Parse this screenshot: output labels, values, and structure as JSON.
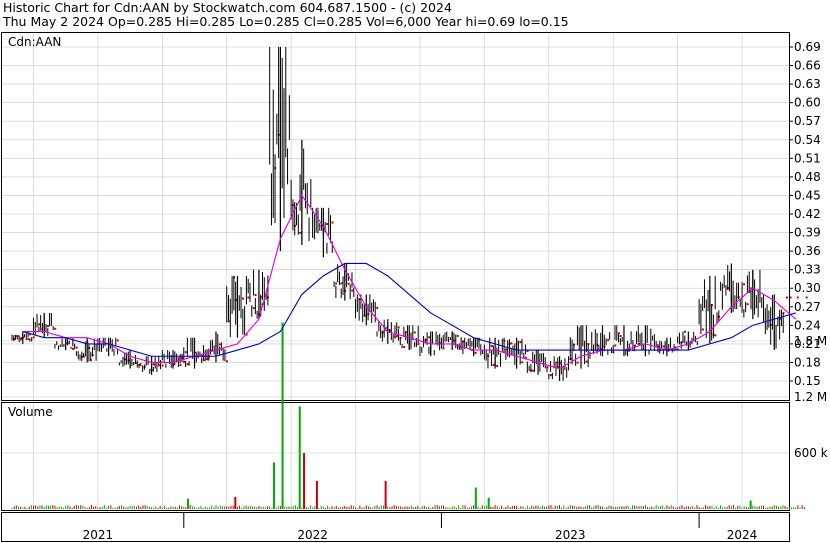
{
  "header": {
    "line1": "Historic Chart for Cdn:AAN by Stockwatch.com 604.687.1500 - (c) 2024",
    "line2": "Thu May  2 2024  Op=0.285  Hi=0.285  Lo=0.285  Cl=0.285  Vol=6,000  Year hi=0.69  lo=0.15"
  },
  "colors": {
    "price_bar": "#000000",
    "down_day_marker": "#cc0000",
    "ma_short": "#e000e0",
    "ma_long": "#0000cc",
    "volume_up": "#00aa00",
    "volume_down": "#cc0000",
    "grid": "#c8c8c8"
  },
  "chart_data": [
    {
      "type": "line",
      "panel": "price",
      "title": "Cdn:AAN",
      "x_axis": {
        "ticks": [
          "2021",
          "2022",
          "2023",
          "2024"
        ],
        "range": [
          "2021-05",
          "2024-05"
        ]
      },
      "y_axis": {
        "ticks": [
          0.69,
          0.66,
          0.63,
          0.6,
          0.57,
          0.54,
          0.51,
          0.48,
          0.45,
          0.42,
          0.39,
          0.36,
          0.33,
          0.3,
          0.27,
          0.24,
          0.21,
          0.18,
          0.15
        ],
        "tick_labels": [
          "0.69",
          "0.66",
          "0.63",
          "0.60",
          "0.57",
          "0.54",
          "0.51",
          "0.48",
          "0.45",
          "0.42",
          "0.39",
          "0.36",
          "0.33",
          "0.30",
          "0.27",
          "0.24",
          "0.21",
          "0.18",
          "0.15"
        ],
        "range": [
          0.15,
          0.69
        ],
        "position": "right"
      },
      "grid": true,
      "price_bars": [
        {
          "date": "2021-05",
          "high": 0.23,
          "low": 0.21
        },
        {
          "date": "2021-06",
          "high": 0.26,
          "low": 0.22
        },
        {
          "date": "2021-07",
          "high": 0.22,
          "low": 0.2
        },
        {
          "date": "2021-08",
          "high": 0.22,
          "low": 0.18
        },
        {
          "date": "2021-09",
          "high": 0.22,
          "low": 0.19
        },
        {
          "date": "2021-10",
          "high": 0.2,
          "low": 0.17
        },
        {
          "date": "2021-11",
          "high": 0.19,
          "low": 0.16
        },
        {
          "date": "2021-12",
          "high": 0.2,
          "low": 0.17
        },
        {
          "date": "2022-01",
          "high": 0.22,
          "low": 0.17
        },
        {
          "date": "2022-02",
          "high": 0.23,
          "low": 0.18
        },
        {
          "date": "2022-03",
          "high": 0.32,
          "low": 0.22
        },
        {
          "date": "2022-04",
          "high": 0.33,
          "low": 0.25
        },
        {
          "date": "2022-05",
          "high": 0.69,
          "low": 0.36
        },
        {
          "date": "2022-06",
          "high": 0.54,
          "low": 0.37
        },
        {
          "date": "2022-07",
          "high": 0.43,
          "low": 0.35
        },
        {
          "date": "2022-08",
          "high": 0.34,
          "low": 0.28
        },
        {
          "date": "2022-09",
          "high": 0.29,
          "low": 0.24
        },
        {
          "date": "2022-10",
          "high": 0.25,
          "low": 0.21
        },
        {
          "date": "2022-11",
          "high": 0.24,
          "low": 0.2
        },
        {
          "date": "2022-12",
          "high": 0.23,
          "low": 0.19
        },
        {
          "date": "2023-01",
          "high": 0.23,
          "low": 0.2
        },
        {
          "date": "2023-02",
          "high": 0.22,
          "low": 0.19
        },
        {
          "date": "2023-03",
          "high": 0.22,
          "low": 0.17
        },
        {
          "date": "2023-04",
          "high": 0.22,
          "low": 0.17
        },
        {
          "date": "2023-05",
          "high": 0.2,
          "low": 0.16
        },
        {
          "date": "2023-06",
          "high": 0.19,
          "low": 0.15
        },
        {
          "date": "2023-07",
          "high": 0.24,
          "low": 0.17
        },
        {
          "date": "2023-08",
          "high": 0.24,
          "low": 0.19
        },
        {
          "date": "2023-09",
          "high": 0.24,
          "low": 0.19
        },
        {
          "date": "2023-10",
          "high": 0.24,
          "low": 0.19
        },
        {
          "date": "2023-11",
          "high": 0.22,
          "low": 0.19
        },
        {
          "date": "2023-12",
          "high": 0.23,
          "low": 0.2
        },
        {
          "date": "2024-01",
          "high": 0.32,
          "low": 0.21
        },
        {
          "date": "2024-02",
          "high": 0.34,
          "low": 0.26
        },
        {
          "date": "2024-03",
          "high": 0.33,
          "low": 0.25
        },
        {
          "date": "2024-04",
          "high": 0.29,
          "low": 0.2
        },
        {
          "date": "2024-05",
          "high": 0.285,
          "low": 0.285
        }
      ],
      "series": [
        {
          "values": [
            0.23,
            0.23,
            0.22,
            0.22,
            0.21,
            0.19,
            0.18,
            0.18,
            0.19,
            0.2,
            0.21,
            0.25,
            0.38,
            0.45,
            0.4,
            0.33,
            0.27,
            0.23,
            0.22,
            0.21,
            0.21,
            0.2,
            0.2,
            0.19,
            0.18,
            0.17,
            0.19,
            0.2,
            0.2,
            0.21,
            0.2,
            0.21,
            0.23,
            0.27,
            0.3,
            0.28,
            0.25
          ]
        },
        {
          "values": [
            0.23,
            0.22,
            0.22,
            0.21,
            0.21,
            0.2,
            0.19,
            0.19,
            0.19,
            0.19,
            0.2,
            0.21,
            0.23,
            0.29,
            0.32,
            0.34,
            0.34,
            0.32,
            0.29,
            0.26,
            0.24,
            0.22,
            0.21,
            0.2,
            0.2,
            0.2,
            0.2,
            0.2,
            0.2,
            0.2,
            0.2,
            0.2,
            0.21,
            0.22,
            0.24,
            0.25,
            0.26
          ]
        }
      ]
    },
    {
      "type": "bar",
      "panel": "volume",
      "title": "Volume",
      "y_axis": {
        "tick_labels": [
          "1.8 M",
          "1.2 M",
          "600 k"
        ],
        "ticks": [
          1800000,
          1200000,
          600000
        ],
        "position": "right"
      },
      "spikes": [
        {
          "date": "2022-01",
          "value": 110000,
          "direction": "up"
        },
        {
          "date": "2022-03",
          "value": 130000,
          "direction": "down"
        },
        {
          "date": "2022-05",
          "value": 2000000,
          "direction": "up"
        },
        {
          "date": "2022-05",
          "value": 500000,
          "direction": "up"
        },
        {
          "date": "2022-06",
          "value": 1100000,
          "direction": "up"
        },
        {
          "date": "2022-06",
          "value": 600000,
          "direction": "down"
        },
        {
          "date": "2022-07",
          "value": 300000,
          "direction": "down"
        },
        {
          "date": "2022-10",
          "value": 300000,
          "direction": "down"
        },
        {
          "date": "2023-02",
          "value": 230000,
          "direction": "up"
        },
        {
          "date": "2023-03",
          "value": 120000,
          "direction": "up"
        },
        {
          "date": "2024-03",
          "value": 90000,
          "direction": "up"
        }
      ]
    }
  ]
}
